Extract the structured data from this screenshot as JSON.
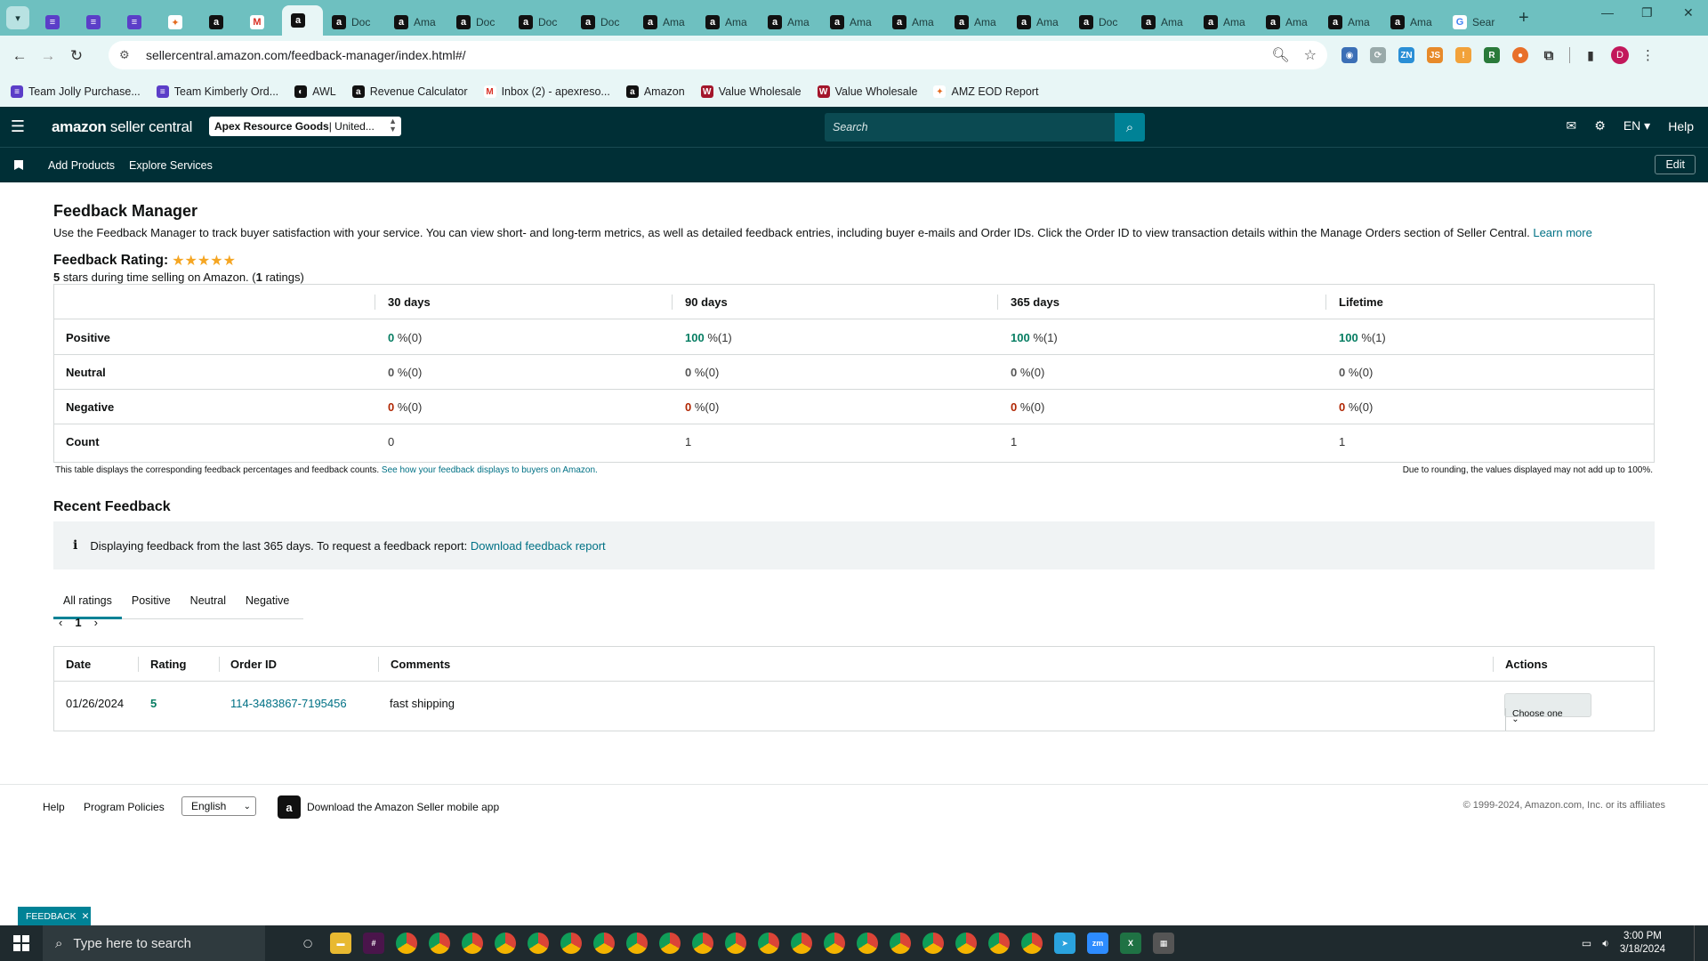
{
  "browser": {
    "tabs": [
      {
        "icon": "list-icon",
        "title": ""
      },
      {
        "icon": "list-icon",
        "title": ""
      },
      {
        "icon": "list-icon",
        "title": ""
      },
      {
        "icon": "clickup-icon",
        "title": ""
      },
      {
        "icon": "amazon-icon",
        "title": ""
      },
      {
        "icon": "gmail-icon",
        "title": ""
      },
      {
        "icon": "amazon-icon",
        "title": "",
        "active": true
      },
      {
        "icon": "amazon-icon",
        "title": "Doc"
      },
      {
        "icon": "amazon-icon",
        "title": "Ama"
      },
      {
        "icon": "amazon-icon",
        "title": "Doc"
      },
      {
        "icon": "amazon-icon",
        "title": "Doc"
      },
      {
        "icon": "amazon-icon",
        "title": "Doc"
      },
      {
        "icon": "amazon-icon",
        "title": "Ama"
      },
      {
        "icon": "amazon-icon",
        "title": "Ama"
      },
      {
        "icon": "amazon-icon",
        "title": "Ama"
      },
      {
        "icon": "amazon-icon",
        "title": "Ama"
      },
      {
        "icon": "amazon-icon",
        "title": "Ama"
      },
      {
        "icon": "amazon-icon",
        "title": "Ama"
      },
      {
        "icon": "amazon-icon",
        "title": "Ama"
      },
      {
        "icon": "amazon-icon",
        "title": "Doc"
      },
      {
        "icon": "amazon-icon",
        "title": "Ama"
      },
      {
        "icon": "amazon-icon",
        "title": "Ama"
      },
      {
        "icon": "amazon-icon",
        "title": "Ama"
      },
      {
        "icon": "amazon-icon",
        "title": "Ama"
      },
      {
        "icon": "amazon-icon",
        "title": "Ama"
      },
      {
        "icon": "google-icon",
        "title": "Sear"
      }
    ],
    "url": "sellercentral.amazon.com/feedback-manager/index.html#/",
    "bookmarks": [
      {
        "icon": "list-icon",
        "label": "Team Jolly Purchase..."
      },
      {
        "icon": "list-icon",
        "label": "Team Kimberly Ord..."
      },
      {
        "icon": "awl-icon",
        "label": "AWL"
      },
      {
        "icon": "amazon-icon",
        "label": "Revenue Calculator"
      },
      {
        "icon": "gmail-icon",
        "label": "Inbox (2) - apexreso..."
      },
      {
        "icon": "amazon-icon",
        "label": "Amazon"
      },
      {
        "icon": "vw-icon",
        "label": "Value Wholesale"
      },
      {
        "icon": "vw-icon",
        "label": "Value Wholesale"
      },
      {
        "icon": "clickup-icon",
        "label": "AMZ EOD Report"
      }
    ],
    "profile_initial": "D"
  },
  "seller_header": {
    "logo_bold": "amazon",
    "logo_rest": " seller central",
    "store_name": "Apex Resource Goods",
    "store_region": " | United...",
    "search_placeholder": "Search",
    "language": "EN",
    "help": "Help",
    "nav_links": [
      "Add Products",
      "Explore Services"
    ],
    "edit": "Edit"
  },
  "page": {
    "title": "Feedback Manager",
    "intro": "Use the Feedback Manager to track buyer satisfaction with your service. You can view short- and long-term metrics, as well as detailed feedback entries, including buyer e-mails and Order IDs. Click the Order ID to view transaction details within the Manage Orders section of Seller Central.",
    "learn_more": "Learn more",
    "rating_label": "Feedback Rating:",
    "stars": "★★★★★",
    "rating_value": "5",
    "rating_text": " stars during time selling on Amazon. (",
    "rating_count": "1",
    "rating_text_end": " ratings)"
  },
  "metrics": {
    "columns": [
      "30 days",
      "90 days",
      "365 days",
      "Lifetime"
    ],
    "rows": [
      {
        "label": "Positive",
        "kind": "pos",
        "cells": [
          [
            "0",
            " %(0)"
          ],
          [
            "100",
            " %(1)"
          ],
          [
            "100",
            " %(1)"
          ],
          [
            "100",
            " %(1)"
          ]
        ]
      },
      {
        "label": "Neutral",
        "kind": "neu",
        "cells": [
          [
            "0",
            " %(0)"
          ],
          [
            "0",
            " %(0)"
          ],
          [
            "0",
            " %(0)"
          ],
          [
            "0",
            " %(0)"
          ]
        ]
      },
      {
        "label": "Negative",
        "kind": "neg",
        "cells": [
          [
            "0",
            " %(0)"
          ],
          [
            "0",
            " %(0)"
          ],
          [
            "0",
            " %(0)"
          ],
          [
            "0",
            " %(0)"
          ]
        ]
      },
      {
        "label": "Count",
        "kind": "count",
        "cells": [
          [
            "",
            "0"
          ],
          [
            "",
            "1"
          ],
          [
            "",
            "1"
          ],
          [
            "",
            "1"
          ]
        ]
      }
    ],
    "footnote": "This table displays the corresponding feedback percentages and feedback counts.",
    "footnote_link": "See how your feedback displays to buyers on Amazon.",
    "rounding_note": "Due to rounding, the values displayed may not add up to 100%."
  },
  "recent": {
    "title": "Recent Feedback",
    "info": "Displaying feedback from the last 365 days. To request a feedback report:",
    "info_link": "Download feedback report",
    "tabs": [
      "All ratings",
      "Positive",
      "Neutral",
      "Negative"
    ],
    "page": "1",
    "headers": [
      "Date",
      "Rating",
      "Order ID",
      "Comments",
      "Actions"
    ],
    "rows": [
      {
        "date": "01/26/2024",
        "rating": "5",
        "order_id": "114-3483867-7195456",
        "comment": "fast shipping",
        "action": "Choose one"
      }
    ]
  },
  "footer": {
    "help": "Help",
    "policies": "Program Policies",
    "language": "English",
    "app_text": "Download the Amazon Seller mobile app",
    "copyright": "© 1999-2024, Amazon.com, Inc. or its affiliates"
  },
  "feedback_tab": "FEEDBACK",
  "taskbar": {
    "search_placeholder": "Type here to search",
    "time": "3:00 PM",
    "date": "3/18/2024"
  }
}
